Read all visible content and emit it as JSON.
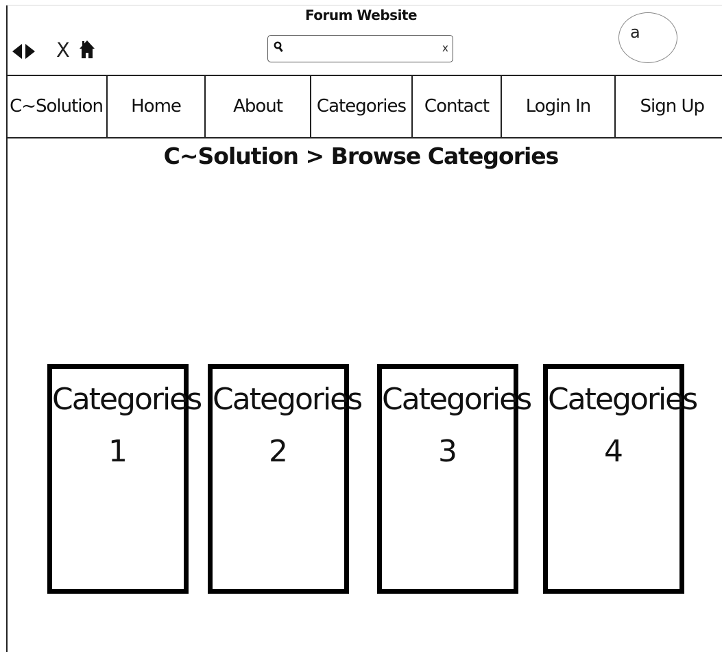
{
  "window": {
    "title": "Forum Website"
  },
  "toolbar": {
    "back_icon": "back-arrow-icon",
    "forward_icon": "forward-arrow-icon",
    "close_label": "X",
    "home_icon": "home-icon"
  },
  "search": {
    "value": "",
    "placeholder": "",
    "clear_label": "x"
  },
  "avatar": {
    "label": "a"
  },
  "nav": {
    "items": [
      {
        "label": "C~Solution"
      },
      {
        "label": "Home"
      },
      {
        "label": "About"
      },
      {
        "label": "Categories"
      },
      {
        "label": "Contact"
      },
      {
        "label": "Login In"
      },
      {
        "label": "Sign Up"
      }
    ]
  },
  "page": {
    "heading": "C~Solution > Browse Categories"
  },
  "categories": [
    {
      "label": "Categories",
      "number": "1"
    },
    {
      "label": "Categories",
      "number": "2"
    },
    {
      "label": "Categories",
      "number": "3"
    },
    {
      "label": "Categories",
      "number": "4"
    }
  ],
  "colors": {
    "border": "#000000",
    "background": "#ffffff",
    "text": "#111111"
  }
}
